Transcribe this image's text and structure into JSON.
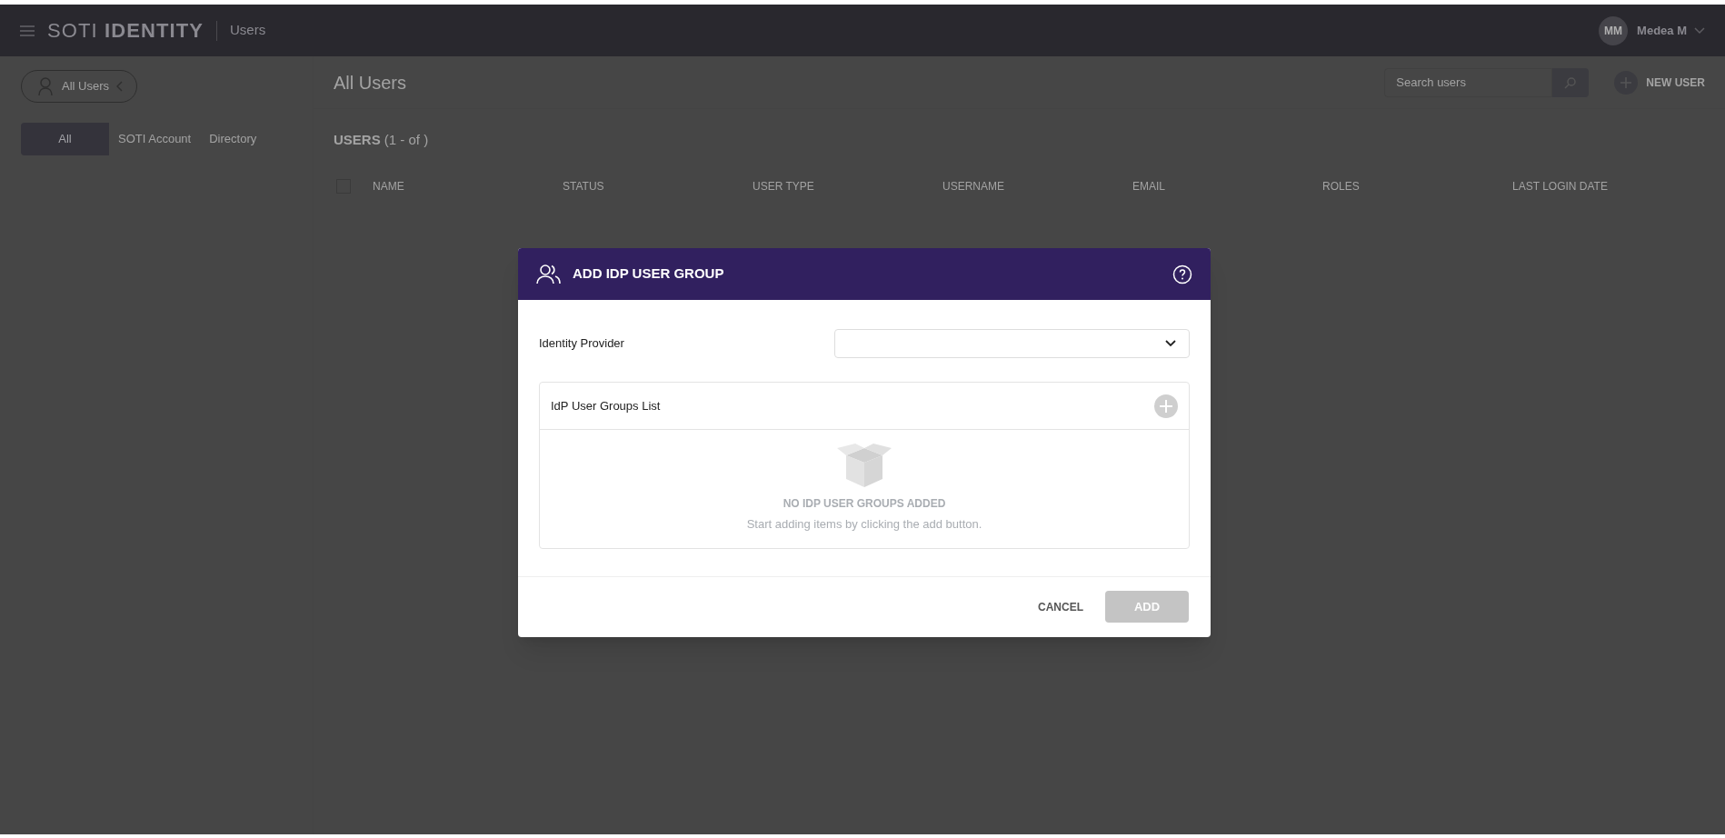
{
  "top_bar": {
    "brand_light": "SOTI",
    "brand_bold": "IDENTITY",
    "section": "Users",
    "user": {
      "initials": "MM",
      "name": "Medea M"
    }
  },
  "sidebar": {
    "filter_button": "All Users",
    "tabs": [
      {
        "label": "All",
        "selected": true
      },
      {
        "label": "SOTI Account",
        "selected": false
      },
      {
        "label": "Directory",
        "selected": false
      }
    ]
  },
  "main": {
    "title": "All Users",
    "search": {
      "placeholder": "Search users"
    },
    "new_user": "NEW USER",
    "count_heading": "**USERS** (1 - of )",
    "table": {
      "select_all": {
        "checked": false
      },
      "columns": [
        "NAME",
        "STATUS",
        "USER TYPE",
        "USERNAME",
        "EMAIL",
        "ROLES",
        "LAST LOGIN DATE"
      ]
    }
  },
  "dialog": {
    "title": "ADD IDP USER GROUP",
    "identity_provider": {
      "label": "Identity Provider"
    },
    "groups_list": {
      "title": "IdP User Groups List",
      "empty_title": "NO IDP USER GROUPS ADDED",
      "empty_text": "Start adding items by clicking the add button."
    },
    "buttons": [
      {
        "label": "CANCEL",
        "kind": "text",
        "disabled": false
      },
      {
        "label": "ADD",
        "kind": "primary",
        "disabled": true
      }
    ]
  }
}
